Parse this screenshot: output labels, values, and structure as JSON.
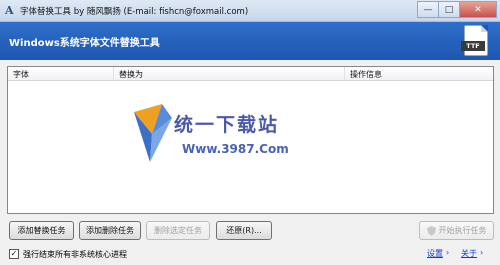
{
  "window": {
    "title": "字体替换工具 by 随风飘扬 (E-mail: fishcn@foxmail.com)",
    "min_symbol": "—",
    "max_symbol": "□",
    "close_symbol": "✕"
  },
  "banner": {
    "title": "Windows系统字体文件替换工具",
    "file_icon_label": "TTF"
  },
  "table": {
    "columns": [
      "字体",
      "替换为",
      "操作信息"
    ]
  },
  "watermark": {
    "name": "统一下载站",
    "url": "Www.3987.Com"
  },
  "buttons": {
    "add_replace": "添加替换任务",
    "add_delete": "添加删除任务",
    "delete_selected": "删除选定任务",
    "restore": "还原(R)...",
    "start": "开始执行任务"
  },
  "footer": {
    "force_close_label": "强行结束所有非系统核心进程",
    "force_close_checked": true,
    "check_mark": "✓",
    "settings_link": "设置",
    "settings_arrow": "›",
    "about_link": "关于",
    "about_arrow": "›"
  }
}
